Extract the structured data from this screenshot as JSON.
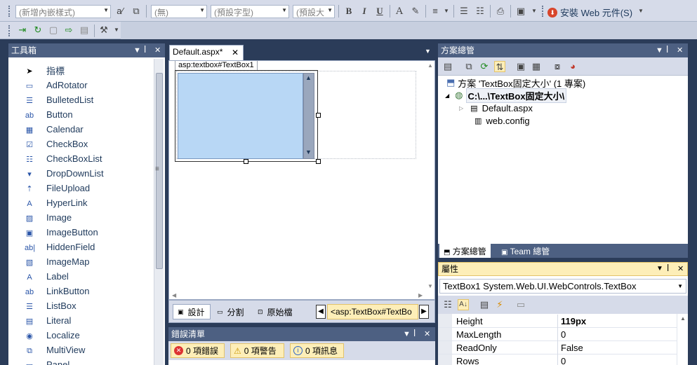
{
  "toolbar1": {
    "block_format": "(新增內嵌樣式)",
    "style": "(無)",
    "font": "(預設字型)",
    "size": "(預設大",
    "bold": "B",
    "italic": "I",
    "underline": "U",
    "install_label": "安裝 Web 元件(S)"
  },
  "toolbox": {
    "title": "工具箱",
    "items": [
      {
        "label": "指標",
        "icon": "pointer-icon"
      },
      {
        "label": "AdRotator",
        "icon": "adrotator-icon"
      },
      {
        "label": "BulletedList",
        "icon": "bulletedlist-icon"
      },
      {
        "label": "Button",
        "icon": "button-icon"
      },
      {
        "label": "Calendar",
        "icon": "calendar-icon"
      },
      {
        "label": "CheckBox",
        "icon": "checkbox-icon"
      },
      {
        "label": "CheckBoxList",
        "icon": "checkboxlist-icon"
      },
      {
        "label": "DropDownList",
        "icon": "dropdownlist-icon"
      },
      {
        "label": "FileUpload",
        "icon": "fileupload-icon"
      },
      {
        "label": "HyperLink",
        "icon": "hyperlink-icon"
      },
      {
        "label": "Image",
        "icon": "image-icon"
      },
      {
        "label": "ImageButton",
        "icon": "imagebutton-icon"
      },
      {
        "label": "HiddenField",
        "icon": "hiddenfield-icon"
      },
      {
        "label": "ImageMap",
        "icon": "imagemap-icon"
      },
      {
        "label": "Label",
        "icon": "label-icon"
      },
      {
        "label": "LinkButton",
        "icon": "linkbutton-icon"
      },
      {
        "label": "ListBox",
        "icon": "listbox-icon"
      },
      {
        "label": "Literal",
        "icon": "literal-icon"
      },
      {
        "label": "Localize",
        "icon": "localize-icon"
      },
      {
        "label": "MultiView",
        "icon": "multiview-icon"
      },
      {
        "label": "Panel",
        "icon": "panel-icon"
      }
    ]
  },
  "editor": {
    "tab": "Default.aspx*",
    "tag_label": "asp:textbox#TextBox1",
    "views": {
      "design": "設計",
      "split": "分割",
      "source": "原始檔"
    },
    "breadcrumb": "<asp:TextBox#TextBo"
  },
  "errors": {
    "title": "錯誤清單",
    "errors": "0 項錯誤",
    "warnings": "0 項警告",
    "messages": "0 項訊息"
  },
  "solution": {
    "title": "方案總管",
    "solution_label": "方案 'TextBox固定大小' (1 專案)",
    "project_label": "C:\\...\\TextBox固定大小\\",
    "files": [
      "Default.aspx",
      "web.config"
    ],
    "tabs": [
      "方案總管",
      "Team 總管"
    ]
  },
  "properties": {
    "title": "屬性",
    "object": "TextBox1",
    "object_type": "System.Web.UI.WebControls.TextBox",
    "rows": [
      {
        "name": "Height",
        "value": "119px"
      },
      {
        "name": "MaxLength",
        "value": "0"
      },
      {
        "name": "ReadOnly",
        "value": "False"
      },
      {
        "name": "Rows",
        "value": "0"
      }
    ]
  }
}
